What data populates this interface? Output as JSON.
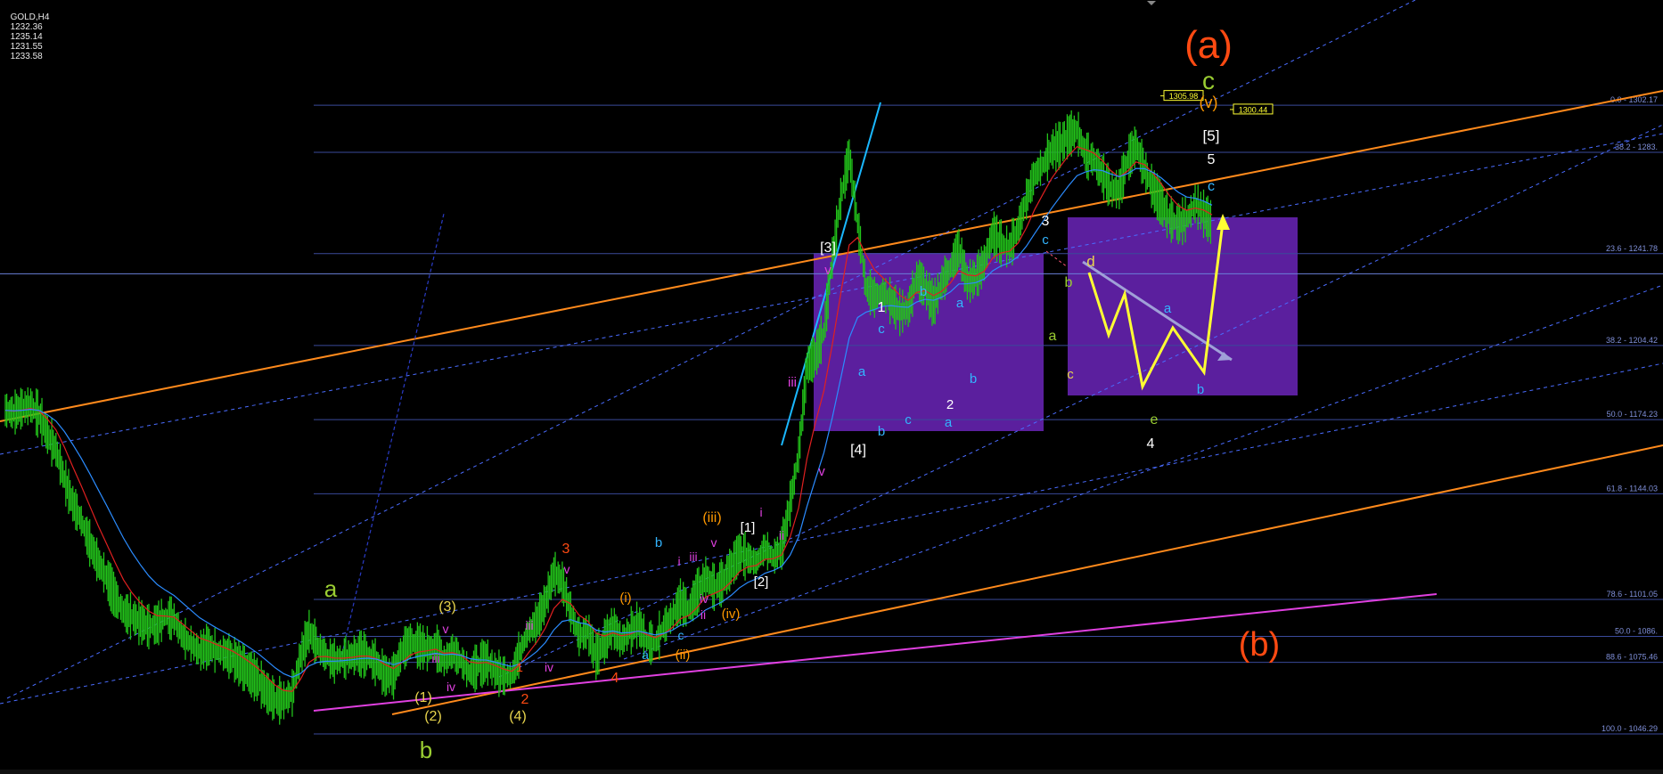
{
  "header": {
    "symbol_timeframe": "GOLD,H4",
    "open": "1232.36",
    "high": "1235.14",
    "low": "1231.55",
    "close": "1233.58"
  },
  "colors": {
    "background": "#000000",
    "candle": "#22c21a",
    "channel_orange": "#ff8a1c",
    "magenta_line": "#e040e0",
    "cyan_line": "#1ab8ff",
    "fib_line": "#3a4a9a",
    "projection_box": "#5b1f9e",
    "projection_arrow": "#ffff33",
    "ema_fast": "#e02020",
    "ema_slow": "#2b8cff"
  },
  "chart_data": {
    "type": "line",
    "title": "",
    "xlabel": "",
    "ylabel": "",
    "ylim": [
      1030,
      1345
    ],
    "grid": false,
    "x": [
      0,
      8,
      16,
      24,
      32,
      40,
      48,
      56,
      64,
      72,
      80,
      88,
      96,
      104,
      112,
      120,
      128,
      136,
      144,
      152,
      160,
      168,
      176,
      184,
      192,
      200,
      208,
      216,
      224,
      232,
      240,
      248,
      256,
      264,
      272,
      280,
      288,
      296,
      304,
      312,
      320,
      328,
      336,
      344,
      352,
      360,
      368,
      376,
      384,
      392,
      400,
      408,
      416,
      424,
      432,
      440,
      448,
      456,
      464,
      472,
      480,
      488,
      496,
      504,
      512,
      520,
      528,
      536,
      544,
      552,
      560,
      568,
      576,
      584,
      592,
      600,
      608,
      616,
      624,
      632,
      640,
      648,
      656,
      664,
      672,
      680,
      688,
      696,
      704,
      712,
      720,
      728,
      736,
      744,
      752,
      760,
      768,
      776,
      784,
      792,
      800,
      808,
      816,
      824,
      832,
      840,
      848,
      856,
      864,
      872,
      880,
      888,
      896,
      904,
      912,
      920,
      928,
      936,
      944,
      952,
      960,
      968,
      976,
      984,
      992,
      1000,
      1008,
      1016,
      1024,
      1032,
      1040,
      1048,
      1056,
      1064,
      1072,
      1080,
      1088,
      1096,
      1104,
      1112,
      1120,
      1128,
      1136,
      1144
    ],
    "series": [
      {
        "values": [
          1178,
          1177,
          1179,
          1180,
          1176,
          1168,
          1162,
          1150,
          1140,
          1133,
          1124,
          1116,
          1110,
          1102,
          1096,
          1094,
          1092,
          1090,
          1091,
          1094,
          1093,
          1086,
          1083,
          1080,
          1082,
          1080,
          1079,
          1077,
          1074,
          1071,
          1068,
          1063,
          1060,
          1060,
          1063,
          1078,
          1088,
          1082,
          1078,
          1076,
          1077,
          1078,
          1079,
          1078,
          1075,
          1070,
          1070,
          1080,
          1084,
          1082,
          1081,
          1082,
          1076,
          1080,
          1076,
          1071,
          1074,
          1076,
          1072,
          1070,
          1070,
          1080,
          1088,
          1092,
          1100,
          1112,
          1108,
          1096,
          1086,
          1088,
          1078,
          1084,
          1090,
          1084,
          1088,
          1091,
          1084,
          1083,
          1090,
          1094,
          1100,
          1097,
          1104,
          1110,
          1106,
          1108,
          1114,
          1120,
          1118,
          1116,
          1122,
          1118,
          1122,
          1140,
          1160,
          1196,
          1200,
          1210,
          1240,
          1264,
          1282,
          1254,
          1228,
          1224,
          1226,
          1222,
          1218,
          1219,
          1232,
          1228,
          1221,
          1230,
          1236,
          1244,
          1230,
          1232,
          1238,
          1250,
          1246,
          1244,
          1252,
          1264,
          1274,
          1278,
          1284,
          1286,
          1290,
          1292,
          1282,
          1280,
          1274,
          1268,
          1268,
          1280,
          1286,
          1276,
          1268,
          1262,
          1256,
          1254,
          1256,
          1262,
          1258,
          1254
        ],
        "annotations": [
          {
            "text": "(a)",
            "color": "#ff4a12"
          },
          {
            "text": "c",
            "color": "#9acd32"
          },
          {
            "text": "(v)",
            "color": "#ff9900"
          },
          {
            "text": "[5]",
            "color": "#ffffff"
          },
          {
            "text": "5",
            "color": "#ffffff"
          },
          {
            "text": "c",
            "color": "#33b5ff"
          },
          {
            "text": "3",
            "color": "#ffffff"
          },
          {
            "text": "c",
            "color": "#33b5ff"
          },
          {
            "text": "d",
            "color": "#e8d44d"
          },
          {
            "text": "b",
            "color": "#9acd32"
          },
          {
            "text": "a",
            "color": "#9acd32"
          },
          {
            "text": "c",
            "color": "#e8d44d"
          },
          {
            "text": "a",
            "color": "#33b5ff"
          },
          {
            "text": "b",
            "color": "#33b5ff"
          },
          {
            "text": "e",
            "color": "#9acd32"
          },
          {
            "text": "4",
            "color": "#ffffff"
          },
          {
            "text": "[3]",
            "color": "#ffffff"
          },
          {
            "text": "v",
            "color": "#e040e0"
          },
          {
            "text": "1",
            "color": "#ffffff"
          },
          {
            "text": "c",
            "color": "#33b5ff"
          },
          {
            "text": "b",
            "color": "#33b5ff"
          },
          {
            "text": "a",
            "color": "#33b5ff"
          },
          {
            "text": "b",
            "color": "#33b5ff"
          },
          {
            "text": "a",
            "color": "#33b5ff"
          },
          {
            "text": "c",
            "color": "#33b5ff"
          },
          {
            "text": "2",
            "color": "#ffffff"
          },
          {
            "text": "a",
            "color": "#33b5ff"
          },
          {
            "text": "b",
            "color": "#33b5ff"
          },
          {
            "text": "[4]",
            "color": "#ffffff"
          },
          {
            "text": "iii",
            "color": "#e040e0"
          },
          {
            "text": "v",
            "color": "#e040e0"
          },
          {
            "text": "i",
            "color": "#e040e0"
          },
          {
            "text": "ii",
            "color": "#e040e0"
          },
          {
            "text": "[1]",
            "color": "#ffffff"
          },
          {
            "text": "[2]",
            "color": "#ffffff"
          },
          {
            "text": "(iii)",
            "color": "#ff9900"
          },
          {
            "text": "v",
            "color": "#e040e0"
          },
          {
            "text": "iii",
            "color": "#e040e0"
          },
          {
            "text": "b",
            "color": "#33b5ff"
          },
          {
            "text": "i",
            "color": "#e040e0"
          },
          {
            "text": "iv",
            "color": "#e040e0"
          },
          {
            "text": "ii",
            "color": "#e040e0"
          },
          {
            "text": "(iv)",
            "color": "#ff9900"
          },
          {
            "text": "(i)",
            "color": "#ff9900"
          },
          {
            "text": "c",
            "color": "#33b5ff"
          },
          {
            "text": "a",
            "color": "#33b5ff"
          },
          {
            "text": "(ii)",
            "color": "#ff9900"
          },
          {
            "text": "3",
            "color": "#ff4a12"
          },
          {
            "text": "v",
            "color": "#e040e0"
          },
          {
            "text": "iii",
            "color": "#e040e0"
          },
          {
            "text": "1",
            "color": "#ff4a12"
          },
          {
            "text": "iv",
            "color": "#e040e0"
          },
          {
            "text": "4",
            "color": "#ff4a12"
          },
          {
            "text": "2",
            "color": "#ff4a12"
          },
          {
            "text": "(3)",
            "color": "#e8d44d"
          },
          {
            "text": "v",
            "color": "#e040e0"
          },
          {
            "text": "iii",
            "color": "#e040e0"
          },
          {
            "text": "iv",
            "color": "#e040e0"
          },
          {
            "text": "(1)",
            "color": "#e8d44d"
          },
          {
            "text": "(2)",
            "color": "#e8d44d"
          },
          {
            "text": "(4)",
            "color": "#e8d44d"
          },
          {
            "text": "a",
            "color": "#9acd32"
          },
          {
            "text": "b",
            "color": "#9acd32"
          },
          {
            "text": "(b)",
            "color": "#ff4a12"
          }
        ]
      }
    ],
    "fib_levels": [
      {
        "label": "0.0 - 1302.17",
        "value": 1302.17
      },
      {
        "label": "38.2 - 1283.",
        "value": 1283
      },
      {
        "label": "23.6 - 1241.78",
        "value": 1241.78
      },
      {
        "label": "38.2 - 1204.42",
        "value": 1204.42
      },
      {
        "label": "50.0 - 1174.23",
        "value": 1174.23
      },
      {
        "label": "61.8 - 1144.03",
        "value": 1144.03
      },
      {
        "label": "78.6 - 1101.05",
        "value": 1101.05
      },
      {
        "label": "50.0 - 1086.",
        "value": 1086
      },
      {
        "label": "88.6 - 1075.46",
        "value": 1075.46
      },
      {
        "label": "100.0 - 1046.29",
        "value": 1046.29
      }
    ],
    "price_tags": [
      {
        "text": "1305.98",
        "value": 1305.98
      },
      {
        "text": "1300.44",
        "value": 1300.44
      }
    ]
  }
}
